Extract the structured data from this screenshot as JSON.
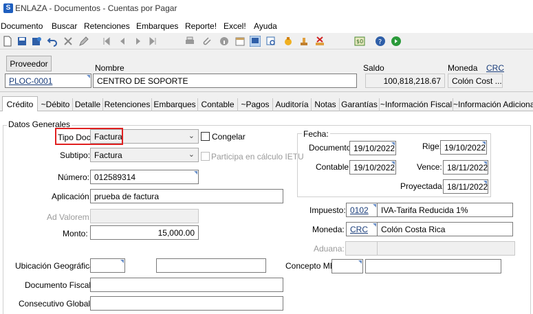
{
  "window": {
    "title": "ENLAZA - Documentos - Cuentas por Pagar",
    "app_icon_letter": "S"
  },
  "menu": [
    "Documento",
    "Buscar",
    "Retenciones",
    "Embarques",
    "Reporte!",
    "Excel!",
    "Ayuda"
  ],
  "toolbar_icons": [
    "new-icon",
    "save-icon",
    "save-as-icon",
    "undo-icon",
    "delete-icon",
    "edit-icon",
    "first-icon",
    "prev-icon",
    "next-icon",
    "last-icon",
    "print-icon",
    "attach-icon",
    "info-icon",
    "calendar-icon",
    "view-icon",
    "find-icon",
    "approve-icon",
    "stamp-icon",
    "cancel-icon",
    "calculator-icon",
    "help-icon",
    "refresh-icon"
  ],
  "header": {
    "proveedor_button": "Proveedor",
    "proveedor_code": "PLOC-0001",
    "nombre_label": "Nombre",
    "nombre_value": "CENTRO DE SOPORTE",
    "saldo_label": "Saldo",
    "saldo_value": "100,818,218.67",
    "moneda_label": "Moneda",
    "moneda_code": "CRC",
    "moneda_value": "Colón Cost ..."
  },
  "tabs": [
    "Crédito",
    "~Débito",
    "Detalle",
    "Retenciones",
    "Embarques",
    "Contable",
    "~Pagos",
    "Auditoría",
    "Notas",
    "Garantías",
    "~Información Fiscal",
    "~Información Adicional"
  ],
  "form": {
    "group_title": "Datos Generales",
    "tipo_doc_label": "Tipo Doc:",
    "tipo_doc_value": "Factura",
    "congelar_label": "Congelar",
    "subtipo_label": "Subtipo:",
    "subtipo_value": "Factura",
    "participa_label": "Participa en cálculo IETU",
    "numero_label": "Número:",
    "numero_value": "012589314",
    "aplicacion_label": "Aplicación:",
    "aplicacion_value": "prueba de factura",
    "ad_valorem_label": "Ad Valorem:",
    "monto_label": "Monto:",
    "monto_value": "15,000.00",
    "ubicacion_label": "Ubicación Geográfica:",
    "documento_fiscal_label": "Documento Fiscal:",
    "consecutivo_label": "Consecutivo Global:",
    "fecha_title": "Fecha:",
    "documento_label": "Documento:",
    "documento_date": "19/10/2022",
    "rige_label": "Rige:",
    "rige_date": "19/10/2022",
    "contable_label": "Contable:",
    "contable_date": "19/10/2022",
    "vence_label": "Vence:",
    "vence_date": "18/11/2022",
    "proyectada_label": "Proyectada:",
    "proyectada_date": "18/11/2022",
    "impuesto_label": "Impuesto:",
    "impuesto_code": "0102",
    "impuesto_desc": "IVA-Tarifa Reducida 1%",
    "moneda_label": "Moneda:",
    "moneda_code": "CRC",
    "moneda_desc": "Colón Costa Rica",
    "aduana_label": "Aduana:",
    "concepto_label": "Concepto ME:"
  }
}
